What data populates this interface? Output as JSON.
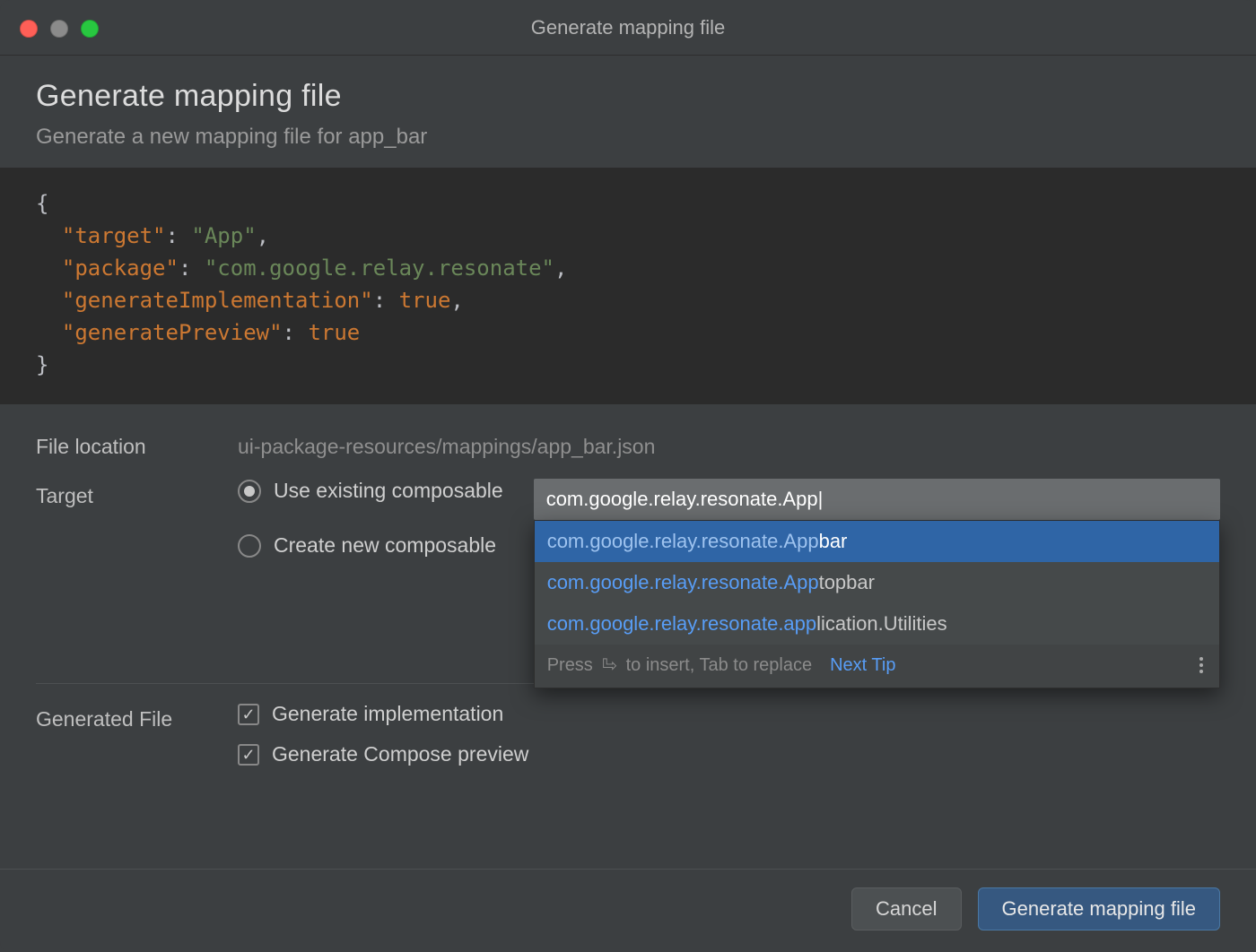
{
  "titlebar": {
    "title": "Generate mapping file"
  },
  "header": {
    "title": "Generate mapping file",
    "subtitle": "Generate a new mapping file for app_bar"
  },
  "code": {
    "target_key": "\"target\"",
    "target_val": "\"App\"",
    "package_key": "\"package\"",
    "package_val": "\"com.google.relay.resonate\"",
    "genimpl_key": "\"generateImplementation\"",
    "genimpl_val": "true",
    "genprev_key": "\"generatePreview\"",
    "genprev_val": "true"
  },
  "form": {
    "file_location_label": "File location",
    "file_location_value": "ui-package-resources/mappings/app_bar.json",
    "target_label": "Target",
    "radio_existing": "Use existing composable",
    "radio_create": "Create new composable",
    "target_input_value": "com.google.relay.resonate.App|",
    "generated_file_label": "Generated File",
    "check_impl": "Generate implementation",
    "check_preview": "Generate Compose preview"
  },
  "autocomplete": {
    "items": [
      {
        "match": "com.google.relay.resonate.App",
        "rest": "bar"
      },
      {
        "match": "com.google.relay.resonate.App",
        "rest": "topbar"
      },
      {
        "match": "com.google.relay.resonate.app",
        "rest": "lication.Utilities"
      }
    ],
    "footer_press": "Press ",
    "footer_insert": " to insert, Tab to replace",
    "footer_link": "Next Tip"
  },
  "footer": {
    "cancel": "Cancel",
    "primary": "Generate mapping file"
  }
}
